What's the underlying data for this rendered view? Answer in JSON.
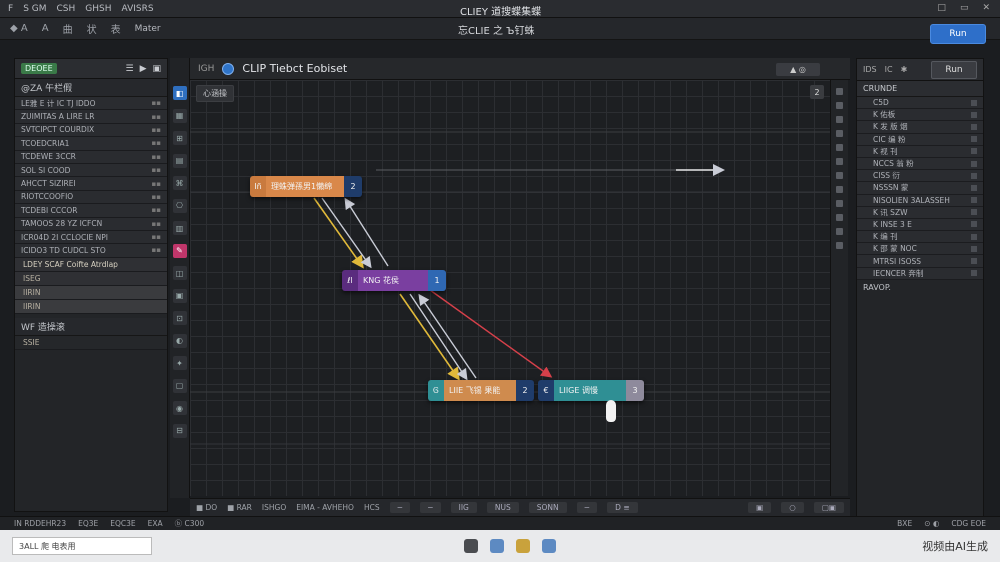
{
  "titlebar": {
    "menus": [
      "F",
      "S GM",
      "CSH",
      "GHSH",
      "AVISRS"
    ],
    "title": "CLIEY 道搜蝶集蝶",
    "controls": [
      "□",
      "▭",
      "✕"
    ]
  },
  "toolbar": {
    "items": [
      "◆ A",
      "A",
      "曲",
      "状",
      "表",
      "Mater"
    ],
    "center_label": "忘CLIE 之 Ъ钉蛛"
  },
  "run_button_top": "Run",
  "left_panel": {
    "badge": "DEOEE",
    "header_icons": [
      "☰",
      "▶",
      "▣"
    ],
    "section_title": "@ZA 午栏假",
    "rows": [
      "LE雅 E 计 IC TJ IDDO",
      "ZUIMITAS A LIRE LR",
      "SVTCIPCT COURDIX",
      "TCOEDCRIA1",
      "TCDEWE 3CCR",
      "SOL SI COOD",
      "AHCCT SIZIREI",
      "RIOTCCOOFIO",
      "TCDEBI CCCOR",
      "TAMOOS 28 YZ ICFCN",
      "ICR04D 2I CCLOCIE NPI",
      "ICIDO3 TD CUDCL STO"
    ],
    "highlight_row": "LDEY SCAF Coifte Atrdlap",
    "sub_items": [
      "ISEG",
      "IIRIN",
      "IIRIN"
    ],
    "section2_title": "WF 造操滚",
    "section2_item": "SSIE"
  },
  "tools": [
    "◧",
    "▦",
    "⊞",
    "▤",
    "⌘",
    "⎔",
    "▥",
    "✎",
    "◫",
    "▣",
    "⊡",
    "◐",
    "✦",
    "▢",
    "◉",
    "⊟"
  ],
  "canvas": {
    "title": "CLIP Tiebct Eobiset",
    "title_prefix": "IGH",
    "header_right": "▲ ◎",
    "breadcrumb": "心涵操",
    "corner": "2"
  },
  "nodes": {
    "n1": {
      "pre": "Iñ",
      "label": "理蛛弹孫男1懶绵",
      "num": "2"
    },
    "n2": {
      "pre": "ℓl",
      "label": "KNG 花侯",
      "num": "1"
    },
    "n3": {
      "pre": "Ꮆ",
      "label": "LIIE 飞锡 果能",
      "num": "2"
    },
    "n4": {
      "pre": "€",
      "label": "LIIGE 调慢",
      "num": "3"
    }
  },
  "right_panel": {
    "header_icons": [
      "IDS",
      "IC",
      "✱"
    ],
    "run_label": "Run",
    "section_title": "CRUNDE",
    "rows": [
      "C5D",
      "K 佑板",
      "K 发 版 烟",
      "CIC 编 粉",
      "K 视 刊",
      "NCCS 翁 粉",
      "CISS 衍",
      "NSSSN 蒙",
      "NISOLIEN 3ALASSEH",
      "K 讯 SZW",
      "K INSE 3 E",
      "K 编 刊",
      "K 邵 蒙 NOC",
      "MTRSI ISOSS",
      "IECNCER 奔制"
    ],
    "footer": "RAVOP."
  },
  "canvas_footer": {
    "items": [
      "■ DO",
      "■ RAR",
      "ISHGO",
      "EIMA - AVHEHO",
      "HCS"
    ],
    "buttons": [
      "─",
      "─",
      "IIG",
      "NUS",
      "SONN",
      "─",
      "D ≡"
    ],
    "right_buttons": [
      "▣",
      "○",
      "▢▣"
    ]
  },
  "statusbar": {
    "items": [
      "IN RDDEHR23",
      "EQ3E",
      "EQC3E",
      "EXA",
      "ⓑ C300"
    ],
    "right": [
      "BXE",
      "⊙ ◐",
      "CDG EOE"
    ]
  },
  "taskbar": {
    "field": "3ALL 爬 电表用",
    "right_text": "视频由AI生成"
  },
  "colors": {
    "accent": "#2e6fc9",
    "node_orange": "#d9884a",
    "node_purple": "#7a3fa0",
    "node_teal": "#2f8f94",
    "node_navy": "#1f3c6a",
    "edge_yellow": "#e0b93a",
    "edge_white": "#c9ccd6",
    "edge_red": "#d6404a"
  }
}
